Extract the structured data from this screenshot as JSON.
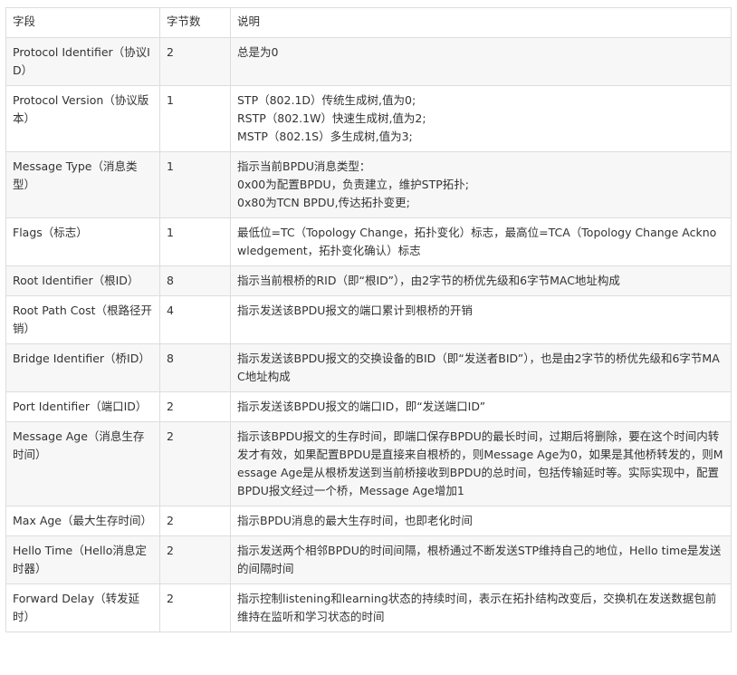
{
  "table": {
    "headers": [
      "字段",
      "字节数",
      "说明"
    ],
    "rows": [
      {
        "field": "Protocol Identifier（协议ID）",
        "bytes": "2",
        "desc": [
          "总是为0"
        ]
      },
      {
        "field": "Protocol Version（协议版本）",
        "bytes": "1",
        "desc": [
          "STP（802.1D）传统生成树,值为0;",
          "RSTP（802.1W）快速生成树,值为2;",
          "MSTP（802.1S）多生成树,值为3;"
        ]
      },
      {
        "field": "Message Type（消息类型）",
        "bytes": "1",
        "desc": [
          "指示当前BPDU消息类型：",
          "0x00为配置BPDU，负责建立，维护STP拓扑;",
          "0x80为TCN BPDU,传达拓扑变更;"
        ]
      },
      {
        "field": "Flags（标志）",
        "bytes": "1",
        "desc": [
          "最低位=TC（Topology Change，拓扑变化）标志，最高位=TCA（Topology Change Acknowledgement，拓扑变化确认）标志"
        ]
      },
      {
        "field": " Root Identifier（根ID）",
        "bytes": "8",
        "desc": [
          "指示当前根桥的RID（即“根ID”），由2字节的桥优先级和6字节MAC地址构成"
        ]
      },
      {
        "field": "Root Path Cost（根路径开销）",
        "bytes": "4",
        "desc": [
          "指示发送该BPDU报文的端口累计到根桥的开销"
        ]
      },
      {
        "field": "Bridge Identifier（桥ID）",
        "bytes": "8",
        "desc": [
          "指示发送该BPDU报文的交换设备的BID（即“发送者BID”），也是由2字节的桥优先级和6字节MAC地址构成"
        ]
      },
      {
        "field": "Port Identifier（端口ID）",
        "bytes": "2",
        "desc": [
          "指示发送该BPDU报文的端口ID，即“发送端口ID”"
        ]
      },
      {
        "field": "Message Age（消息生存时间）",
        "bytes": "2",
        "desc": [
          "指示该BPDU报文的生存时间，即端口保存BPDU的最长时间，过期后将删除，要在这个时间内转发才有效，如果配置BPDU是直接来自根桥的，则Message Age为0，如果是其他桥转发的，则Message Age是从根桥发送到当前桥接收到BPDU的总时间，包括传输延时等。实际实现中，配置BPDU报文经过一个桥，Message Age增加1"
        ]
      },
      {
        "field": "Max Age（最大生存时间）",
        "bytes": "2",
        "desc": [
          "指示BPDU消息的最大生存时间，也即老化时间"
        ]
      },
      {
        "field": "Hello Time（Hello消息定时器）",
        "bytes": "2",
        "desc": [
          "指示发送两个相邻BPDU的时间间隔，根桥通过不断发送STP维持自己的地位，Hello time是发送的间隔时间"
        ]
      },
      {
        "field": "Forward Delay（转发延时）",
        "bytes": "2",
        "desc": [
          "指示控制listening和learning状态的持续时间，表示在拓扑结构改变后，交换机在发送数据包前维持在监听和学习状态的时间"
        ]
      }
    ]
  }
}
